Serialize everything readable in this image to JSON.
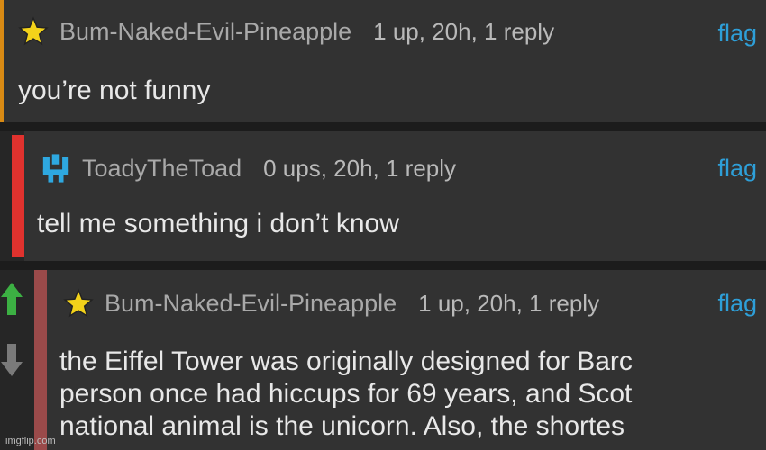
{
  "comments": [
    {
      "user": "Bum-Naked-Evil-Pineapple",
      "stats": "1 up, 20h, 1 reply",
      "flag": "flag",
      "text": "you’re not funny",
      "accent": "#d88a14"
    },
    {
      "user": "ToadyTheToad",
      "stats": "0 ups, 20h, 1 reply",
      "flag": "flag",
      "text": "tell me something i don’t know",
      "accent": "#e0322e"
    },
    {
      "user": "Bum-Naked-Evil-Pineapple",
      "stats": "1 up, 20h, 1 reply",
      "flag": "flag",
      "lines": [
        "the Eiffel Tower was originally designed for Barc",
        "person once had hiccups for 69 years, and Scot",
        "national animal is the unicorn. Also, the shortes"
      ],
      "accent": "#9a4a4a"
    }
  ],
  "watermark": "imgflip.com",
  "colors": {
    "flag": "#2e9fd8",
    "star": "#f3d21a",
    "upvote": "#3cb043"
  },
  "icons": [
    "star-icon",
    "pixel-avatar-icon",
    "upvote-arrow-icon",
    "downvote-arrow-icon"
  ]
}
